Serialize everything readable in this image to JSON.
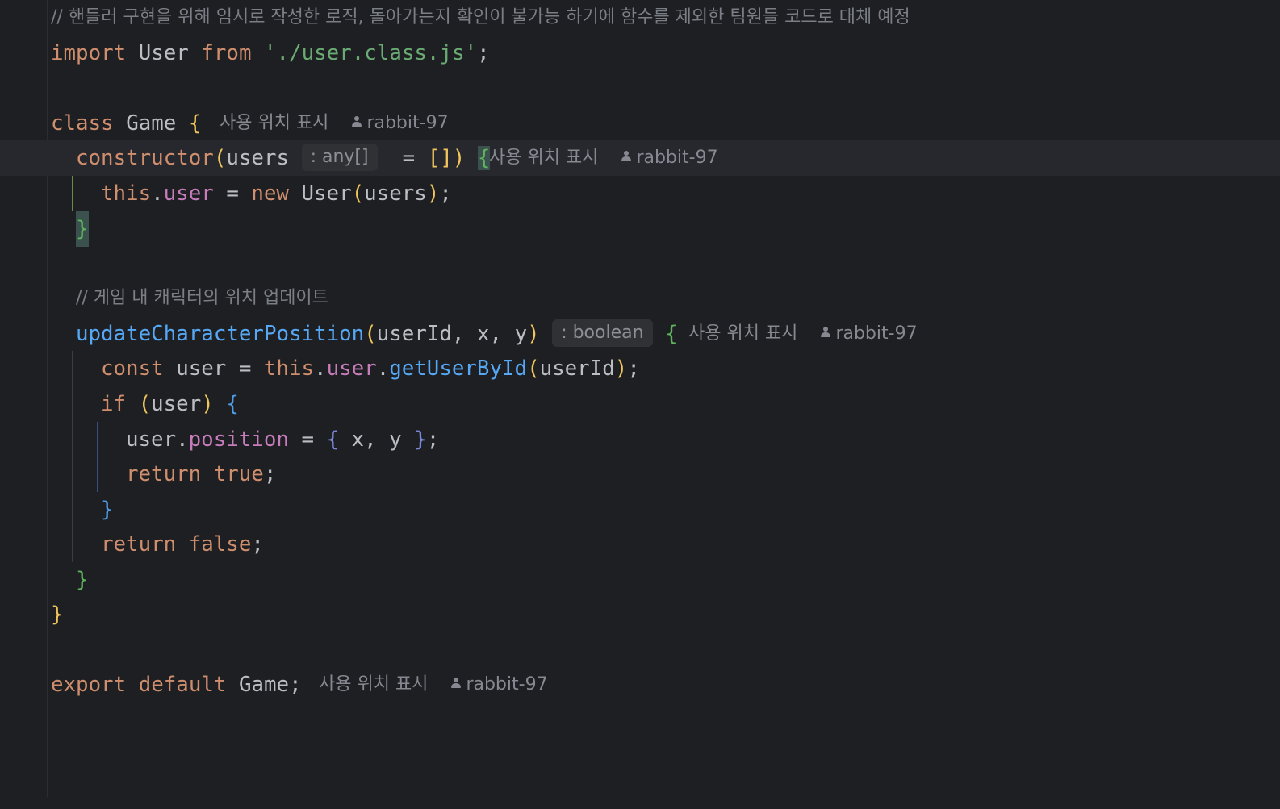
{
  "editor": {
    "header_comment": "// 핸들러 구현을 위해 임시로 작성한 로직, 돌아가는지 확인이 불가능 하기에 함수를 제외한 팀원들 코드로 대체 예정",
    "import_kw": "import",
    "import_name": "User",
    "from_kw": "from",
    "import_path": "'./user.class.js'",
    "semi": ";",
    "class_kw": "class",
    "class_name": "Game",
    "open_brace": "{",
    "close_brace": "}",
    "constructor_kw": "constructor",
    "open_paren": "(",
    "close_paren": ")",
    "param_users": "users",
    "hint_any": ": any[]",
    "eq": "=",
    "empty_array": "[]",
    "this_kw": "this",
    "dot": ".",
    "field_user": "user",
    "new_kw": "new",
    "user_class": "User",
    "arg_users": "users",
    "method_comment": "// 게임 내 캐릭터의 위치 업데이트",
    "method_name": "updateCharacterPosition",
    "params": "userId, x, y",
    "hint_boolean": ": boolean",
    "const_kw": "const",
    "local_user": "user",
    "method_getuser": "getUserById",
    "arg_userid": "userId",
    "if_kw": "if",
    "cond_user": "user",
    "position_field": "position",
    "obj_literal_inner": " x, y ",
    "return_kw": "return",
    "true_kw": "true",
    "false_kw": "false",
    "export_kw": "export",
    "default_kw": "default",
    "export_name": "Game"
  },
  "vision": {
    "usages": "사용 위치 표시",
    "author": "rabbit-97",
    "author_icon": "person-icon"
  }
}
